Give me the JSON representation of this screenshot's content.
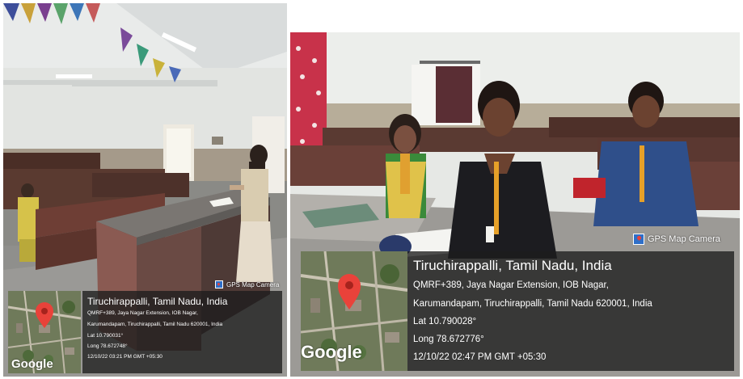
{
  "left_photo": {
    "stamp_label": "GPS Map Camera",
    "map_logo": "Google",
    "place": "Tiruchirappalli, Tamil Nadu, India",
    "address_line1": "QMRF+389, Jaya Nagar Extension, IOB Nagar,",
    "address_line2": "Karumandapam, Tiruchirappalli, Tamil Nadu 620001, India",
    "lat": "Lat 10.790031°",
    "long": "Long 78.672748°",
    "timestamp": "12/10/22 03:21 PM GMT +05:30"
  },
  "right_photo": {
    "stamp_label": "GPS Map Camera",
    "map_logo": "Google",
    "place": "Tiruchirappalli, Tamil Nadu, India",
    "address_line1": "QMRF+389, Jaya Nagar Extension, IOB Nagar,",
    "address_line2": "Karumandapam, Tiruchirappalli, Tamil Nadu 620001, India",
    "lat": "Lat 10.790028°",
    "long": "Long 78.672776°",
    "timestamp": "12/10/22 02:47 PM GMT +05:30"
  },
  "colors": {
    "overlay": "#1c1c1c",
    "pin": "#e9423a",
    "stamp_icon": "#2f6fc8"
  }
}
